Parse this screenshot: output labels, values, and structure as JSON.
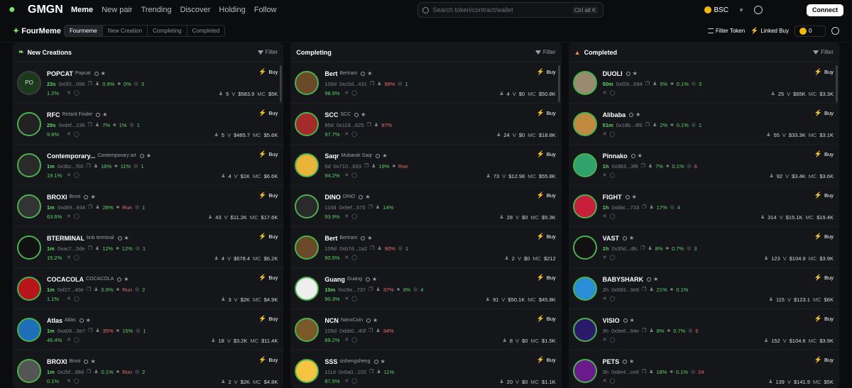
{
  "topbar": {
    "logo": "GMGN",
    "nav": [
      "Meme",
      "New pair",
      "Trending",
      "Discover",
      "Holding",
      "Follow"
    ],
    "search_placeholder": "Search token/contract/wallet",
    "kbd": "Ctrl alt K",
    "chain": "BSC",
    "connect": "Connect"
  },
  "subbar": {
    "brand": "FourMeme",
    "tabs": [
      "Fourmeme",
      "New Creation",
      "Completing",
      "Completed"
    ],
    "filter_token": "Filter Token",
    "linked_buy": "Linked Buy",
    "amount": "0"
  },
  "columns": [
    {
      "title": "New Creations",
      "filter": "Filter",
      "icon": "sprout-icon",
      "rows": [
        {
          "sym": "POPCAT",
          "name": "Popcat",
          "avatar": "PO",
          "grey": true,
          "age": "23s",
          "new": true,
          "ca": "0x0f2...056",
          "h1": "0.9%",
          "h2": "0%",
          "h2c": "g",
          "h3": "3",
          "pct": "1.2%",
          "holders": "5",
          "vol": "$583.9",
          "mc": "$5K"
        },
        {
          "sym": "RFC",
          "name": "Retard Finder",
          "avatar": "",
          "age": "29s",
          "new": true,
          "ca": "0xdef...236",
          "h1": "7%",
          "h2": "1%",
          "h2c": "g",
          "h3": "1",
          "pct": "9.6%",
          "holders": "5",
          "vol": "$485.7",
          "mc": "$5.6K"
        },
        {
          "sym": "Contemporary...",
          "name": "Contemporary art",
          "avatar": "",
          "age": "1m",
          "new": true,
          "ca": "0x3bc...f00",
          "h1": "16%",
          "h2": "11%",
          "h2c": "g",
          "h3": "1",
          "pct": "19.1%",
          "holders": "4",
          "vol": "$1K",
          "mc": "$6.6K"
        },
        {
          "sym": "BROXI",
          "name": "Broxi",
          "avatar": "",
          "age": "1m",
          "new": true,
          "ca": "0xd89...934",
          "h1": "28%",
          "h2": "Run",
          "h2c": "r",
          "h3": "1",
          "pct": "63.6%",
          "holders": "43",
          "vol": "$11.2K",
          "mc": "$17.6K"
        },
        {
          "sym": "BTERMINAL",
          "name": "bnb terminal",
          "avatar": "",
          "age": "1m",
          "new": true,
          "ca": "0xac7...5de",
          "h1": "12%",
          "h2": "12%",
          "h2c": "g",
          "h3": "1",
          "pct": "15.2%",
          "holders": "4",
          "vol": "$678.4",
          "mc": "$6.2K"
        },
        {
          "sym": "COCACOLA",
          "name": "COCACOLA",
          "avatar": "",
          "age": "1m",
          "new": true,
          "ca": "0xf27...43e",
          "h1": "0.9%",
          "h2": "Run",
          "h2c": "r",
          "h3": "2",
          "pct": "1.1%",
          "holders": "3",
          "vol": "$2K",
          "mc": "$4.9K"
        },
        {
          "sym": "Atlas",
          "name": "Atlas",
          "avatar": "",
          "age": "1m",
          "new": true,
          "ca": "0xa06...3e7",
          "h1": "35%",
          "h1c": "r",
          "h2": "15%",
          "h2c": "g",
          "h3": "1",
          "pct": "46.4%",
          "holders": "18",
          "vol": "$3.2K",
          "mc": "$11.4K"
        },
        {
          "sym": "BROXI",
          "name": "Broxi",
          "avatar": "",
          "age": "1m",
          "new": true,
          "ca": "0x2bf...98d",
          "h1": "0.1%",
          "h2": "Run",
          "h2c": "r",
          "h3": "2",
          "pct": "0.1%",
          "holders": "2",
          "vol": "$2K",
          "mc": "$4.8K"
        }
      ]
    },
    {
      "title": "Completing",
      "filter": "Filter",
      "rows": [
        {
          "sym": "Bert",
          "name": "Bertram",
          "age": "109d",
          "ca": "0xc0d...431",
          "h1": "98%",
          "h1c": "r",
          "h3": "1",
          "pct": "98.9%",
          "holders": "4",
          "vol": "$0",
          "mc": "$50.8K"
        },
        {
          "sym": "SCC",
          "name": "SCC",
          "age": "85d",
          "ca": "0x119...625",
          "h1": "97%",
          "h1c": "r",
          "pct": "97.7%",
          "holders": "24",
          "vol": "$0",
          "mc": "$18.8K"
        },
        {
          "sym": "Saqr",
          "name": "Mubarak Saqr",
          "age": "5d",
          "ca": "0x710...833",
          "h1": "19%",
          "h2": "Run",
          "h2c": "r",
          "pct": "94.2%",
          "holders": "73",
          "vol": "$12.98",
          "mc": "$55.8K"
        },
        {
          "sym": "DINO",
          "name": "DINO",
          "age": "110d",
          "ca": "0x9ef...575",
          "h1": "14%",
          "pct": "93.9%",
          "holders": "28",
          "vol": "$0",
          "mc": "$5.3K"
        },
        {
          "sym": "Bert",
          "name": "Bertram",
          "age": "109d",
          "ca": "0xb7d...1a2",
          "h1": "90%",
          "h1c": "r",
          "h3": "1",
          "pct": "90.5%",
          "holders": "2",
          "vol": "$0",
          "mc": "$212"
        },
        {
          "sym": "Guang",
          "name": "Guang",
          "age": "10m",
          "new": true,
          "ca": "0xc6e...737",
          "h1": "37%",
          "h1c": "r",
          "h2": "3%",
          "h2c": "g",
          "h3": "4",
          "pct": "90.3%",
          "holders": "91",
          "vol": "$50.1K",
          "mc": "$45.8K"
        },
        {
          "sym": "NCN",
          "name": "NanoCoin",
          "age": "109d",
          "ca": "0xbb0...40f",
          "h1": "34%",
          "h1c": "r",
          "pct": "89.2%",
          "holders": "8",
          "vol": "$0",
          "mc": "$1.5K"
        },
        {
          "sym": "SSS",
          "name": "sishengsheng",
          "age": "111d",
          "ca": "0x6a0...102",
          "h1": "11%",
          "pct": "87.5%",
          "holders": "20",
          "vol": "$0",
          "mc": "$1.1K"
        }
      ]
    },
    {
      "title": "Completed",
      "filter": "Filter",
      "rows": [
        {
          "sym": "DUOLI",
          "name": "",
          "age": "50m",
          "new": true,
          "ca": "0xf29...694",
          "h1": "5%",
          "h2": "0.1%",
          "h2c": "g",
          "h3": "3",
          "holders": "25",
          "vol": "$65K",
          "mc": "$3.3K"
        },
        {
          "sym": "Alibaba",
          "name": "",
          "age": "51m",
          "new": true,
          "ca": "0x18b...4f6",
          "h1": "2%",
          "h2": "0.1%",
          "h2c": "g",
          "h3": "1",
          "holders": "55",
          "vol": "$33.3K",
          "mc": "$3.1K"
        },
        {
          "sym": "Pinnako",
          "name": "",
          "age": "1h",
          "new": true,
          "ca": "0x983...3f8",
          "h1": "7%",
          "h2": "0.1%",
          "h2c": "g",
          "h3": "6",
          "h3c": "r",
          "holders": "92",
          "vol": "$3.4K",
          "mc": "$3.6K"
        },
        {
          "sym": "FIGHT",
          "name": "",
          "age": "1h",
          "new": true,
          "ca": "0xbbc...733",
          "h1": "17%",
          "h3": "4",
          "holders": "314",
          "vol": "$15.1K",
          "mc": "$19.4K"
        },
        {
          "sym": "VAST",
          "name": "",
          "age": "1h",
          "new": true,
          "ca": "0x35d...dfc",
          "h1": "8%",
          "h2": "0.7%",
          "h2c": "g",
          "h3": "3",
          "holders": "123",
          "vol": "$104.9",
          "mc": "$3.9K"
        },
        {
          "sym": "BABYSHARK",
          "name": "",
          "age": "2h",
          "ca": "0x683...3e6",
          "h1": "21%",
          "h2": "0.1%",
          "h2c": "g",
          "holders": "115",
          "vol": "$123.1",
          "mc": "$6K"
        },
        {
          "sym": "VISIO",
          "name": "",
          "age": "3h",
          "ca": "0x9e6...94e",
          "h1": "8%",
          "h2": "0.7%",
          "h2c": "g",
          "h3": "6",
          "h3c": "r",
          "holders": "152",
          "vol": "$104.6",
          "mc": "$3.9K"
        },
        {
          "sym": "PETS",
          "name": "",
          "age": "3h",
          "ca": "0x8e4...ce6",
          "h1": "18%",
          "h2": "0.1%",
          "h2c": "g",
          "h3": "24",
          "h3c": "r",
          "holders": "139",
          "vol": "$141.9",
          "mc": "$5K"
        }
      ]
    }
  ],
  "buy_label": "Buy",
  "vol_prefix": "V",
  "mc_prefix": "MC"
}
